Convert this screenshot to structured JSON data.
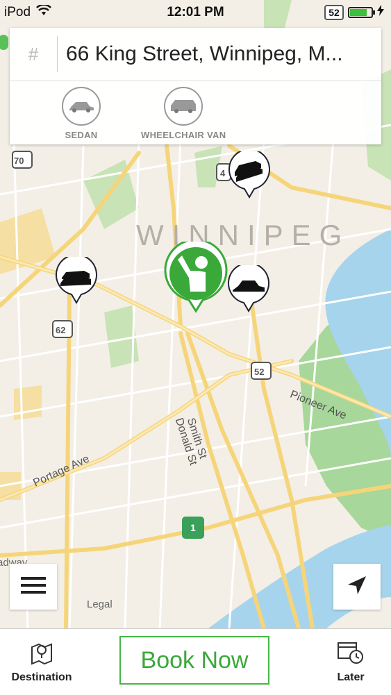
{
  "status_bar": {
    "carrier": "iPod",
    "time": "12:01 PM",
    "route_badge": "52",
    "battery_level": 0.8,
    "icons": [
      "wifi-icon",
      "battery-icon",
      "charging-icon"
    ]
  },
  "address": {
    "hash_symbol": "#",
    "value": "66 King Street, Winnipeg, M..."
  },
  "vehicles": [
    {
      "label": "SEDAN",
      "icon": "sedan-icon"
    },
    {
      "label": "WHEELCHAIR VAN",
      "icon": "van-icon"
    }
  ],
  "map": {
    "city_label": "WINNIPEG",
    "streets": [
      "Pioneer Ave",
      "Smith St",
      "Donald St",
      "Portage Ave"
    ],
    "route_shields": [
      "70",
      "4",
      "62",
      "52",
      "1"
    ],
    "legal": "Legal",
    "partial_label": "adway"
  },
  "bottom_bar": {
    "destination_label": "Destination",
    "book_now_label": "Book Now",
    "later_label": "Later"
  },
  "colors": {
    "accent_green": "#3aa93a",
    "water": "#a6d4ec",
    "park": "#a7d79a"
  }
}
